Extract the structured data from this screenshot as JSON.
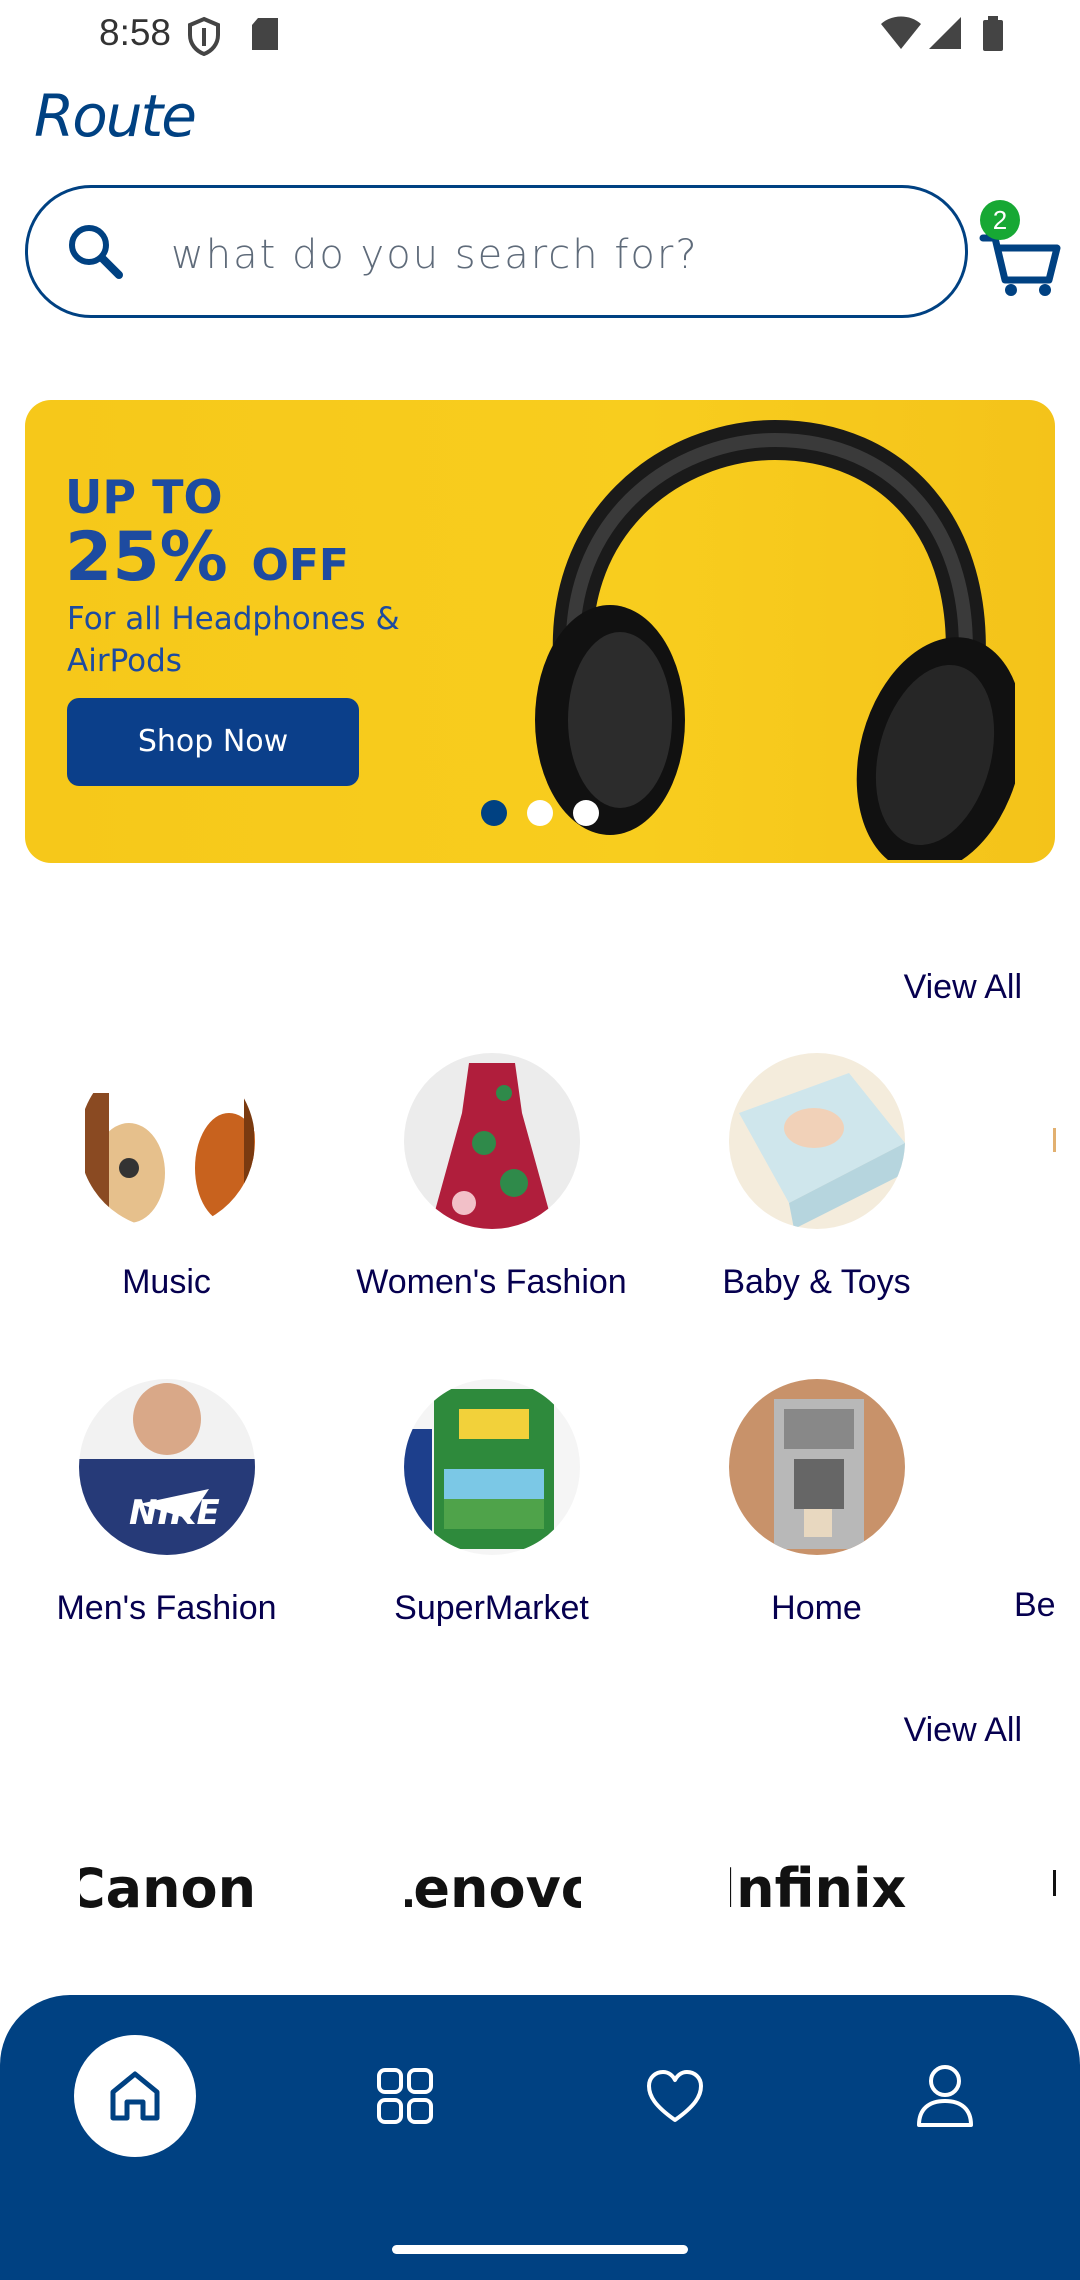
{
  "status_bar": {
    "time": "8:58",
    "icons": [
      "shield-icon",
      "sd-card-icon",
      "wifi-icon",
      "signal-icon",
      "battery-icon"
    ]
  },
  "app": {
    "logo_text": "Route"
  },
  "search": {
    "placeholder": "what do you search for?",
    "icon": "search-icon"
  },
  "cart": {
    "icon": "cart-icon",
    "badge_count": "2"
  },
  "banner": {
    "line1": "UP TO",
    "line2_big": "25%",
    "line2_small": "OFF",
    "line3": "For all Headphones & AirPods",
    "button_label": "Shop Now",
    "slides": 3,
    "active_slide": 1
  },
  "categories": {
    "view_all_label": "View All",
    "items": [
      {
        "label": "Music"
      },
      {
        "label": "Women's Fashion"
      },
      {
        "label": "Baby & Toys"
      },
      {
        "label": "Men's Fashion"
      },
      {
        "label": "SuperMarket"
      },
      {
        "label": "Home"
      },
      {
        "label": "Be"
      }
    ]
  },
  "brands": {
    "view_all_label": "View All",
    "items": [
      {
        "label": "Canon"
      },
      {
        "label": "Lenovo"
      },
      {
        "label": "Infinix"
      }
    ]
  },
  "bottom_nav": {
    "items": [
      {
        "icon": "home-icon",
        "active": true
      },
      {
        "icon": "categories-icon",
        "active": false
      },
      {
        "icon": "heart-icon",
        "active": false
      },
      {
        "icon": "profile-icon",
        "active": false
      }
    ]
  },
  "colors": {
    "primary": "#004182",
    "badge": "#17a834",
    "banner_bg": "#f8cd1e",
    "text": "#06004f"
  }
}
